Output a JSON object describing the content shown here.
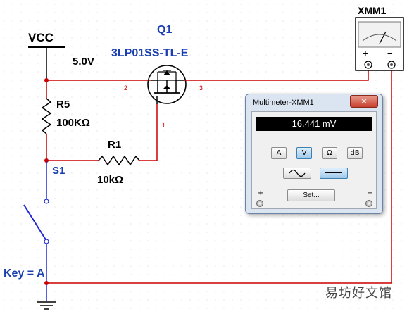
{
  "schematic": {
    "vcc": {
      "name": "VCC",
      "voltage": "5.0V"
    },
    "q1": {
      "ref": "Q1",
      "part": "3LP01SS-TL-E",
      "pin_left": "2",
      "pin_right": "3",
      "pin_gate": "1"
    },
    "r5": {
      "ref": "R5",
      "value": "100KΩ"
    },
    "r1": {
      "ref": "R1",
      "value": "10kΩ"
    },
    "s1": {
      "ref": "S1",
      "key": "Key = A"
    },
    "xmm1": {
      "ref": "XMM1",
      "plus": "+",
      "minus": "−"
    }
  },
  "multimeter": {
    "title": "Multimeter-XMM1",
    "close_label": "✕",
    "reading": "16.441 mV",
    "modes": [
      "A",
      "V",
      "Ω",
      "dB"
    ],
    "selected_mode": "V",
    "set_label": "Set...",
    "plus": "+",
    "minus": "−"
  },
  "watermark": "易坊好文馆",
  "colors": {
    "wire_red": "#cc0000",
    "wire_blue": "#1f2ad6",
    "label_blue": "#1a3fb0"
  }
}
